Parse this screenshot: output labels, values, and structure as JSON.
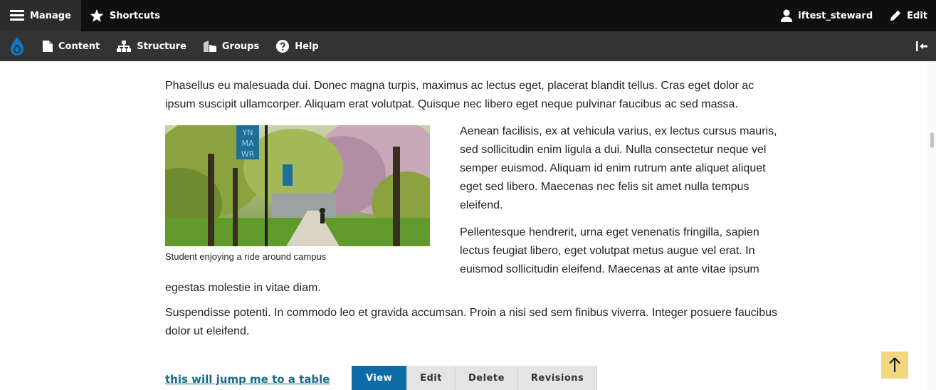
{
  "toolbar": {
    "manage_label": "Manage",
    "shortcuts_label": "Shortcuts",
    "user_label": "iftest_steward",
    "edit_label": "Edit"
  },
  "tray": {
    "content_label": "Content",
    "structure_label": "Structure",
    "groups_label": "Groups",
    "help_label": "Help"
  },
  "article": {
    "intro": "Phasellus eu malesuada dui. Donec magna turpis, maximus ac lectus eget, placerat blandit tellus. Cras eget dolor ac ipsum suscipit ullamcorper. Aliquam erat volutpat. Quisque nec libero eget neque pulvinar faucibus ac sed massa.",
    "image_caption": "Student enjoying a ride around campus",
    "banner_text": "YN MA WR",
    "side_para_1": "Aenean facilisis, ex at vehicula varius, ex lectus cursus mauris, sed sollicitudin enim ligula a dui. Nulla consectetur neque vel semper euismod. Aliquam id enim rutrum ante aliquet aliquet eget sed libero. Maecenas nec felis sit amet nulla tempus eleifend.",
    "side_para_2": "Pellentesque hendrerit, urna eget venenatis fringilla, sapien lectus feugiat libero, eget volutpat metus augue vel erat. In euismod sollicitudin eleifend. Maecenas at ante vitae ipsum egestas molestie in vitae diam.",
    "after_para": "Suspendisse potenti. In commodo leo et gravida accumsan. Proin a nisi sed sem finibus viverra. Integer posuere faucibus dolor ut eleifend.",
    "jump_link": "this will jump me to a table"
  },
  "tabs": [
    {
      "label": "View",
      "active": true
    },
    {
      "label": "Edit",
      "active": false
    },
    {
      "label": "Delete",
      "active": false
    },
    {
      "label": "Revisions",
      "active": false
    }
  ],
  "colors": {
    "toolbar_bg": "#0f0f0f",
    "tray_bg": "#333333",
    "drupal_blue": "#0d7bc8",
    "active_tab": "#0d6ba6",
    "back_to_top": "#f3d77e"
  }
}
